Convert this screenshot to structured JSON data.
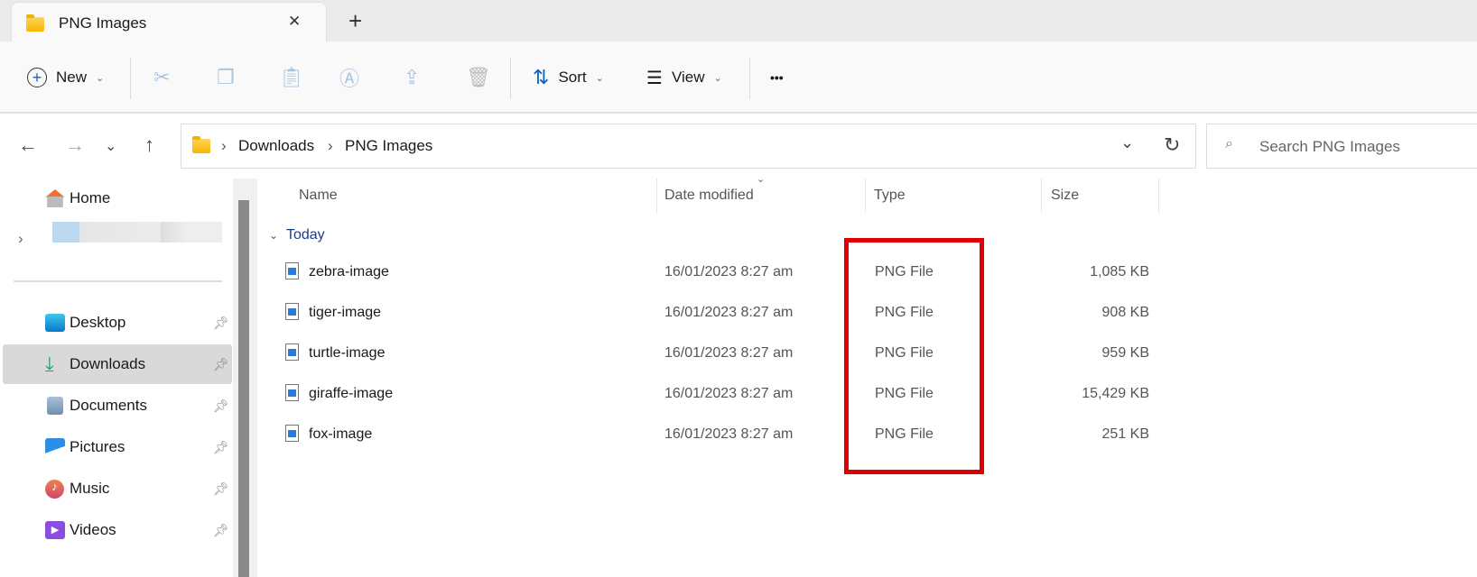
{
  "tab": {
    "title": "PNG Images",
    "close": "✕",
    "new_tab": "+"
  },
  "toolbar": {
    "new": "New",
    "sort": "Sort",
    "view": "View",
    "more": "•••"
  },
  "address": {
    "crumbs": [
      "Downloads",
      "PNG Images"
    ],
    "sep": "›"
  },
  "search": {
    "placeholder": "Search PNG Images"
  },
  "sidebar": {
    "home": "Home",
    "items": [
      {
        "label": "Desktop",
        "icon": "desktop-icon"
      },
      {
        "label": "Downloads",
        "icon": "downloads-icon"
      },
      {
        "label": "Documents",
        "icon": "documents-icon"
      },
      {
        "label": "Pictures",
        "icon": "pictures-icon"
      },
      {
        "label": "Music",
        "icon": "music-icon"
      },
      {
        "label": "Videos",
        "icon": "videos-icon"
      }
    ]
  },
  "columns": {
    "name": "Name",
    "date": "Date modified",
    "type": "Type",
    "size": "Size"
  },
  "group": "Today",
  "files": [
    {
      "name": "zebra-image",
      "date": "16/01/2023 8:27 am",
      "type": "PNG File",
      "size": "1,085 KB"
    },
    {
      "name": "tiger-image",
      "date": "16/01/2023 8:27 am",
      "type": "PNG File",
      "size": "908 KB"
    },
    {
      "name": "turtle-image",
      "date": "16/01/2023 8:27 am",
      "type": "PNG File",
      "size": "959 KB"
    },
    {
      "name": "giraffe-image",
      "date": "16/01/2023 8:27 am",
      "type": "PNG File",
      "size": "15,429 KB"
    },
    {
      "name": "fox-image",
      "date": "16/01/2023 8:27 am",
      "type": "PNG File",
      "size": "251 KB"
    }
  ],
  "colors": {
    "highlight": "#e00000",
    "selected": "#d9d9d9"
  }
}
